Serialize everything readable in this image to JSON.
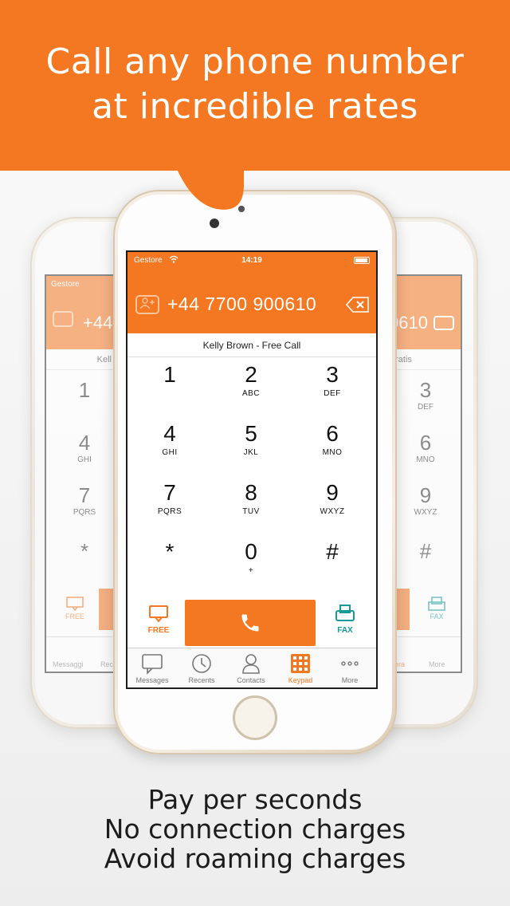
{
  "banner": {
    "line1": "Call any phone number",
    "line2": "at incredible rates"
  },
  "colors": {
    "accent": "#f47721",
    "fax": "#139b9a"
  },
  "status": {
    "carrier": "Gestore",
    "time": "14:19"
  },
  "dialer": {
    "number": "+44 7700 900610",
    "contact_line": "Kelly Brown - Free Call",
    "keys": [
      {
        "digit": "1",
        "letters": ""
      },
      {
        "digit": "2",
        "letters": "ABC"
      },
      {
        "digit": "3",
        "letters": "DEF"
      },
      {
        "digit": "4",
        "letters": "GHI"
      },
      {
        "digit": "5",
        "letters": "JKL"
      },
      {
        "digit": "6",
        "letters": "MNO"
      },
      {
        "digit": "7",
        "letters": "PQRS"
      },
      {
        "digit": "8",
        "letters": "TUV"
      },
      {
        "digit": "9",
        "letters": "WXYZ"
      },
      {
        "digit": "*",
        "letters": ""
      },
      {
        "digit": "0",
        "letters": "+"
      },
      {
        "digit": "#",
        "letters": ""
      }
    ],
    "free_label": "FREE",
    "fax_label": "FAX"
  },
  "tabs": [
    {
      "label": "Messages",
      "icon": "chat-bubble-icon"
    },
    {
      "label": "Recents",
      "icon": "clock-icon"
    },
    {
      "label": "Contacts",
      "icon": "person-icon"
    },
    {
      "label": "Keypad",
      "icon": "keypad-icon",
      "active": true
    },
    {
      "label": "More",
      "icon": "more-dots-icon"
    }
  ],
  "left_phone": {
    "carrier": "Gestore",
    "number_partial": "+44",
    "contact_partial": "Kell",
    "keys": [
      {
        "digit": "1",
        "letters": ""
      },
      {
        "digit": "4",
        "letters": "GHI"
      },
      {
        "digit": "7",
        "letters": "PQRS"
      },
      {
        "digit": "*",
        "letters": ""
      }
    ],
    "free_label": "FREE",
    "tabs": [
      "Messaggi",
      "Rec"
    ]
  },
  "right_phone": {
    "number_partial": "0610",
    "contact_partial": "gratis",
    "keys": [
      {
        "digit": "3",
        "letters": "DEF"
      },
      {
        "digit": "6",
        "letters": "MNO"
      },
      {
        "digit": "9",
        "letters": "WXYZ"
      },
      {
        "digit": "#",
        "letters": ""
      }
    ],
    "fax_label": "FAX",
    "tabs": [
      "stiera",
      "More"
    ]
  },
  "taglines": [
    "Pay per seconds",
    "No connection charges",
    "Avoid roaming charges"
  ]
}
